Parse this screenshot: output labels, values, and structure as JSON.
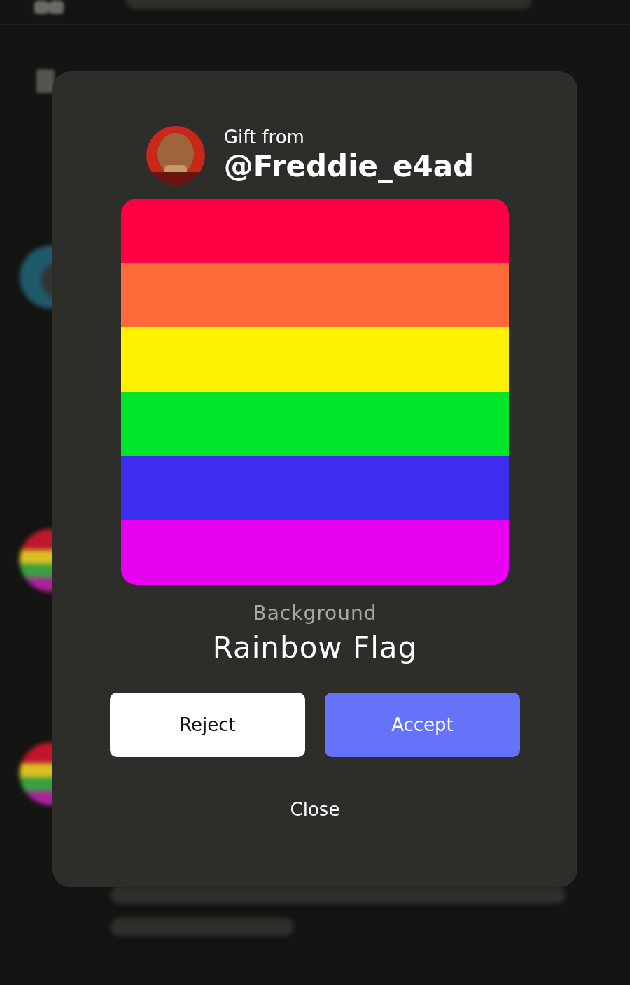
{
  "gift_dialog": {
    "caption": "Gift from",
    "sender": "@Freddie_e4ad",
    "item_kind": "Background",
    "item_name": "Rainbow Flag",
    "buttons": [
      {
        "label": "Reject",
        "kind": "secondary"
      },
      {
        "label": "Accept",
        "kind": "primary"
      }
    ],
    "close": "Close"
  }
}
